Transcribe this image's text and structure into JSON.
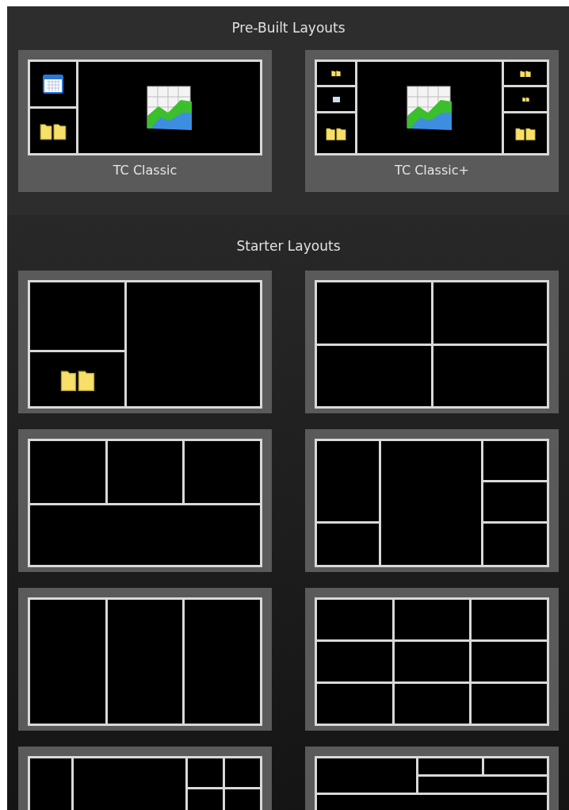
{
  "prebuilt": {
    "title": "Pre-Built Layouts",
    "layouts": [
      {
        "label": "TC Classic",
        "kind": "classic"
      },
      {
        "label": "TC Classic+",
        "kind": "classic-plus"
      }
    ]
  },
  "starter": {
    "title": "Starter Layouts",
    "layouts": [
      {
        "kind": "left-split"
      },
      {
        "kind": "quad"
      },
      {
        "kind": "three-over-one"
      },
      {
        "kind": "side-stacks"
      },
      {
        "kind": "three-columns"
      },
      {
        "kind": "nine-grid"
      },
      {
        "kind": "wide-center"
      },
      {
        "kind": "top-split"
      }
    ]
  }
}
